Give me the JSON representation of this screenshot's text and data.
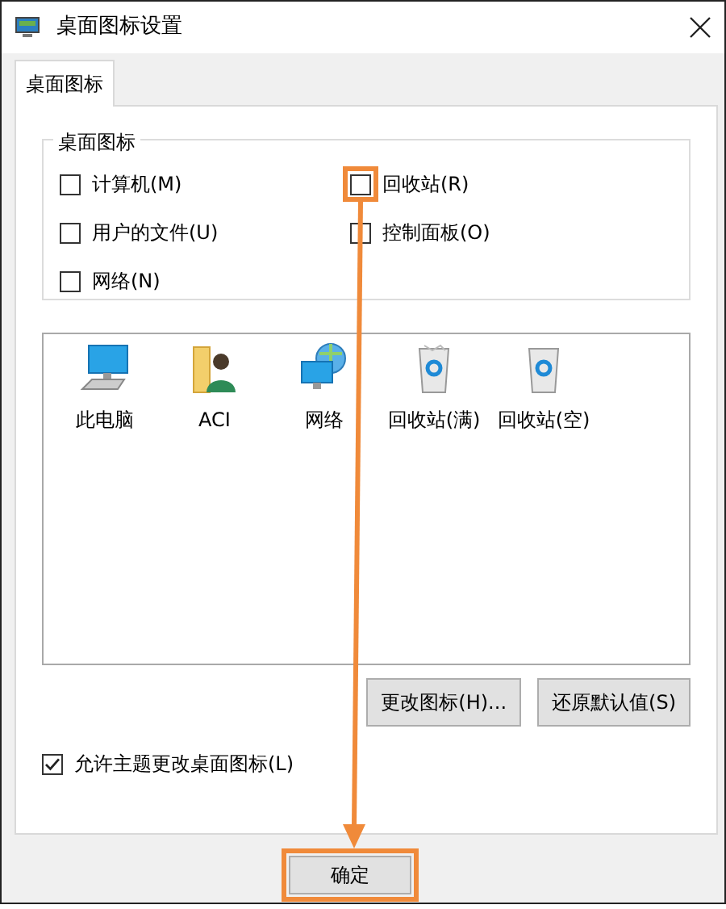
{
  "window": {
    "title": "桌面图标设置"
  },
  "tabs": [
    {
      "label": "桌面图标",
      "selected": true
    }
  ],
  "group": {
    "title": "桌面图标",
    "checkboxes": [
      {
        "label": "计算机(M)",
        "checked": false,
        "highlighted": false
      },
      {
        "label": "回收站(R)",
        "checked": false,
        "highlighted": true
      },
      {
        "label": "用户的文件(U)",
        "checked": false,
        "highlighted": false
      },
      {
        "label": "控制面板(O)",
        "checked": false,
        "highlighted": false
      },
      {
        "label": "网络(N)",
        "checked": false,
        "highlighted": false
      }
    ]
  },
  "icons": [
    {
      "label": "此电脑",
      "kind": "computer"
    },
    {
      "label": "ACI",
      "kind": "user"
    },
    {
      "label": "网络",
      "kind": "network"
    },
    {
      "label": "回收站(满)",
      "kind": "bin-full"
    },
    {
      "label": "回收站(空)",
      "kind": "bin-empty"
    }
  ],
  "icon_buttons": [
    "更改图标(H)...",
    "还原默认值(S)"
  ],
  "theme_checkbox": {
    "label": "允许主题更改桌面图标(L)",
    "checked": true
  },
  "footer_buttons": [
    {
      "label": "确定",
      "highlighted": true
    }
  ]
}
